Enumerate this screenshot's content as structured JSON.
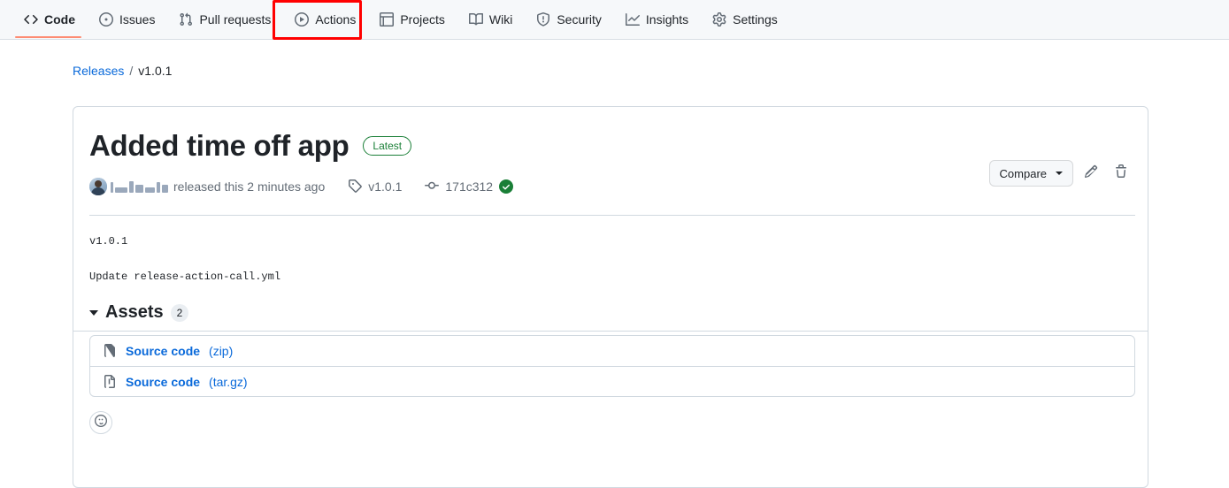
{
  "repo_nav": {
    "items": [
      {
        "label": "Code",
        "icon": "code-icon",
        "active": true
      },
      {
        "label": "Issues",
        "icon": "issue-opened-icon",
        "active": false
      },
      {
        "label": "Pull requests",
        "icon": "git-pull-request-icon",
        "active": false
      },
      {
        "label": "Actions",
        "icon": "play-icon",
        "active": false
      },
      {
        "label": "Projects",
        "icon": "table-icon",
        "active": false
      },
      {
        "label": "Wiki",
        "icon": "book-icon",
        "active": false
      },
      {
        "label": "Security",
        "icon": "shield-icon",
        "active": false
      },
      {
        "label": "Insights",
        "icon": "graph-icon",
        "active": false
      },
      {
        "label": "Settings",
        "icon": "gear-icon",
        "active": false
      }
    ],
    "active_underline_color": "#fd8c73"
  },
  "annotation": {
    "target_label": "Actions",
    "box_color": "#ff0000"
  },
  "breadcrumb": {
    "root_label": "Releases",
    "separator": "/",
    "current_label": "v1.0.1"
  },
  "release": {
    "title": "Added time off app",
    "latest_badge": "Latest",
    "latest_badge_color": "#1a7f37",
    "actions": {
      "compare_label": "Compare",
      "edit_icon": "pencil-icon",
      "delete_icon": "trash-icon"
    },
    "meta": {
      "author_redacted": true,
      "released_text": "released this",
      "time_ago": "2 minutes ago",
      "tag_icon": "tag-icon",
      "tag_label": "v1.0.1",
      "commit_icon": "git-commit-icon",
      "commit_sha": "171c312",
      "verified_icon": "verified-check-icon",
      "verified_color": "#1a7f37"
    },
    "body_lines": [
      "v1.0.1",
      "Update release-action-call.yml"
    ]
  },
  "assets": {
    "title": "Assets",
    "count": "2",
    "collapse_icon": "triangle-down-icon",
    "items": [
      {
        "icon": "file-zip-icon",
        "name": "Source code",
        "ext": "(zip)"
      },
      {
        "icon": "file-zip-icon",
        "name": "Source code",
        "ext": "(tar.gz)"
      }
    ]
  },
  "reactions": {
    "add_icon": "smiley-icon"
  }
}
